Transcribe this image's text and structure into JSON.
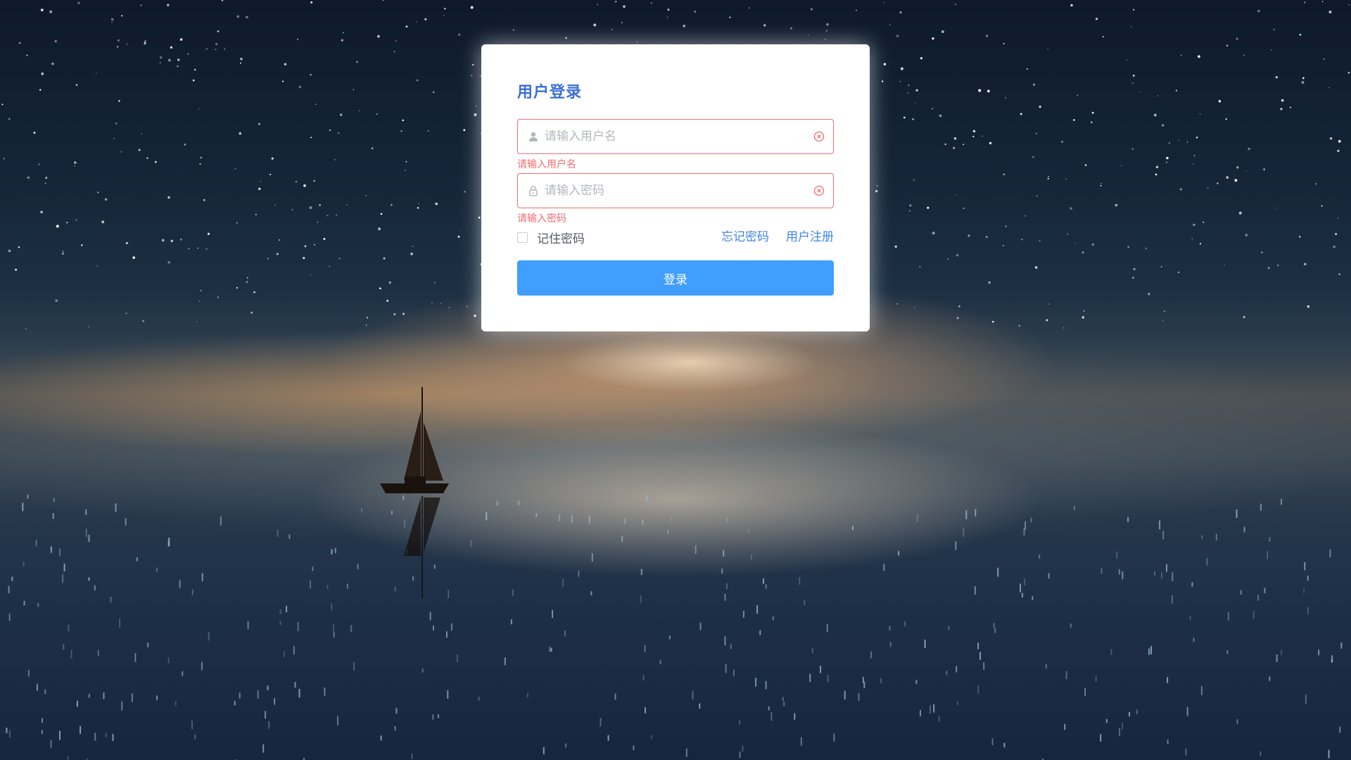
{
  "login": {
    "title": "用户登录",
    "username": {
      "placeholder": "请输入用户名",
      "value": "",
      "error": "请输入用户名"
    },
    "password": {
      "placeholder": "请输入密码",
      "value": "",
      "error": "请输入密码"
    },
    "remember_label": "记住密码",
    "remember_checked": false,
    "forgot_password_link": "忘记密码",
    "register_link": "用户注册",
    "submit_label": "登录"
  },
  "colors": {
    "title": "#3b6fd4",
    "error": "#f56c6c",
    "link": "#3f86e6",
    "button": "#409eff"
  },
  "icons": {
    "username_prefix": "user-icon",
    "password_prefix": "lock-icon",
    "clear": "circle-close-icon"
  }
}
